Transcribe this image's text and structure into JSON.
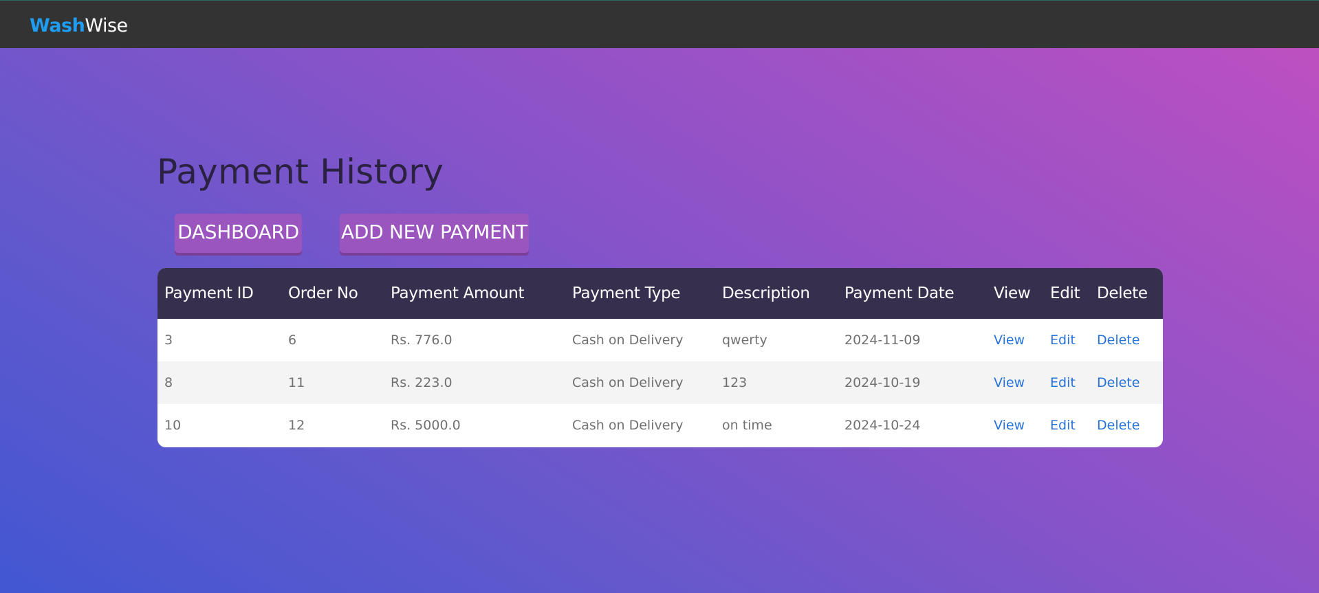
{
  "navbar": {
    "logo_part1": "Wash",
    "logo_part2": "Wise"
  },
  "page": {
    "title": "Payment History"
  },
  "buttons": {
    "dashboard": "DASHBOARD",
    "add_payment": "ADD NEW PAYMENT"
  },
  "table": {
    "headers": [
      "Payment ID",
      "Order No",
      "Payment Amount",
      "Payment Type",
      "Description",
      "Payment Date",
      "View",
      "Edit",
      "Delete"
    ],
    "rows": [
      {
        "payment_id": "3",
        "order_no": "6",
        "amount": "Rs. 776.0",
        "type": "Cash on Delivery",
        "description": "qwerty",
        "date": "2024-11-09",
        "view": "View",
        "edit": "Edit",
        "delete": "Delete"
      },
      {
        "payment_id": "8",
        "order_no": "11",
        "amount": "Rs. 223.0",
        "type": "Cash on Delivery",
        "description": "123",
        "date": "2024-10-19",
        "view": "View",
        "edit": "Edit",
        "delete": "Delete"
      },
      {
        "payment_id": "10",
        "order_no": "12",
        "amount": "Rs. 5000.0",
        "type": "Cash on Delivery",
        "description": "on time",
        "date": "2024-10-24",
        "view": "View",
        "edit": "Edit",
        "delete": "Delete"
      }
    ]
  },
  "colors": {
    "navbar_bg": "#333333",
    "logo_accent": "#1e9df2",
    "table_header_bg": "#372f4e",
    "link": "#2672d8",
    "button_bg": "#9b55bf"
  }
}
